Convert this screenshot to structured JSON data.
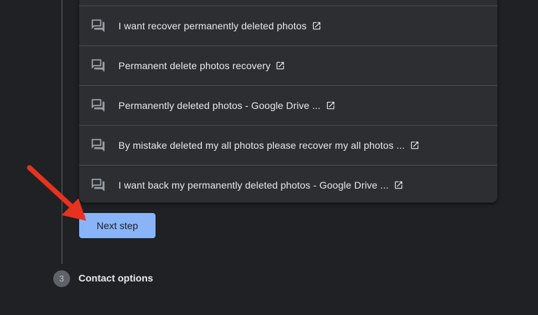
{
  "results": [
    {
      "text": "I want recover permanently deleted photos",
      "icon": "feedback-icon"
    },
    {
      "text": "Permanent delete photos recovery",
      "icon": "feedback-icon"
    },
    {
      "text": "Permanently deleted photos - Google Drive ...",
      "icon": "feedback-icon"
    },
    {
      "text": "By mistake deleted my all photos please recover my all photos ...",
      "icon": "feedback-icon"
    },
    {
      "text": "I want back my permanently deleted photos - Google Drive ...",
      "icon": "feedback-icon"
    }
  ],
  "next_button": {
    "label": "Next step"
  },
  "step": {
    "number": "3",
    "title": "Contact options"
  },
  "colors": {
    "background": "#202124",
    "card": "#2d2e31",
    "accent": "#8ab4f8",
    "arrow": "#e8321f"
  }
}
